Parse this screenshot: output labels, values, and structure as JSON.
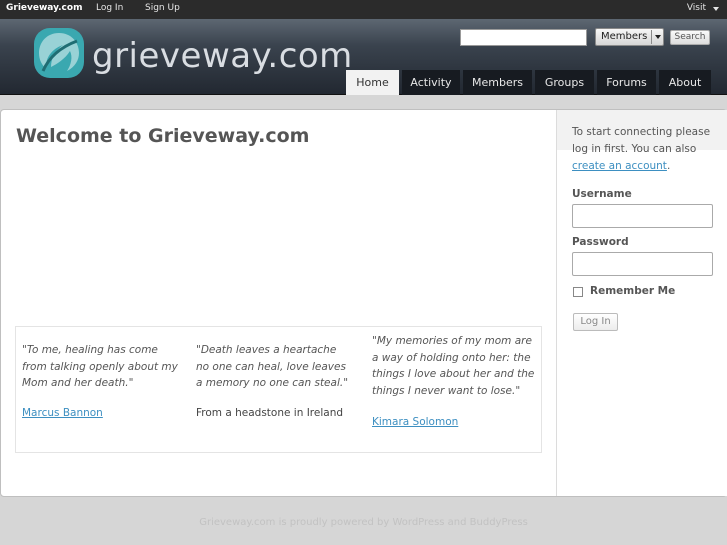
{
  "adminbar": {
    "brand": "Grieveway.com",
    "login": "Log In",
    "signup": "Sign Up",
    "visit": "Visit"
  },
  "header": {
    "logo_text": "grieveway.com",
    "search_placeholder": "",
    "search_scope": "Members",
    "search_button": "Search"
  },
  "nav": {
    "tabs": [
      {
        "label": "Home",
        "active": true
      },
      {
        "label": "Activity"
      },
      {
        "label": "Members"
      },
      {
        "label": "Groups"
      },
      {
        "label": "Forums"
      },
      {
        "label": "About"
      }
    ]
  },
  "main": {
    "title": "Welcome to Grieveway.com",
    "quotes": [
      {
        "text": "\"To me, healing has come from talking openly about my Mom and her death.\"",
        "source": "Marcus Bannon"
      },
      {
        "text": "\"Death leaves a heartache no one can heal, love leaves a memory no one can steal.\"",
        "source": "From a headstone in Ireland"
      },
      {
        "text": "\"My memories of my mom are a way of holding onto her: the things I love about her and the things I never want to lose.\"",
        "source": "Kimara Solomon"
      }
    ]
  },
  "sidebar": {
    "intro_1": "To start connecting please log in first. You can also",
    "create_link": "create an account",
    "intro_end": ".",
    "username_label": "Username",
    "password_label": "Password",
    "remember_label": "Remember Me",
    "login_button": "Log In"
  },
  "footer": {
    "text": "Grieveway.com is proudly powered by WordPress and BuddyPress"
  },
  "colors": {
    "accent": "#3d8fc1",
    "logo_teal": "#3aa8b0"
  }
}
